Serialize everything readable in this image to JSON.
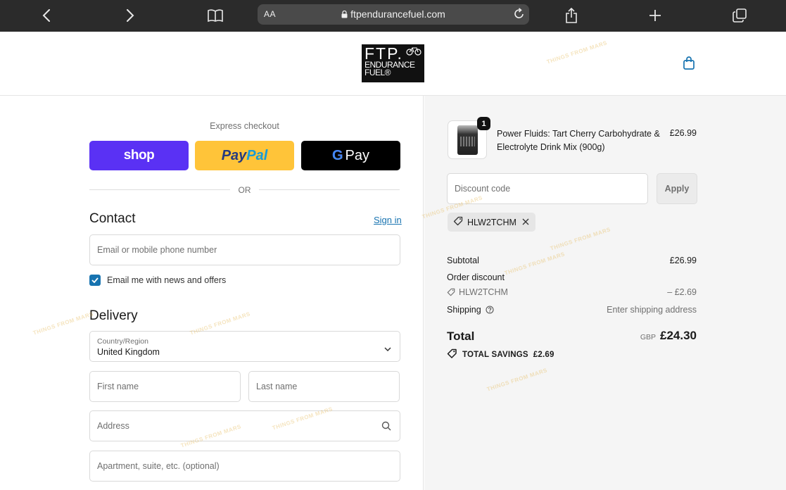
{
  "browser": {
    "text_size_label": "AA",
    "url": "ftpendurancefuel.com"
  },
  "store": {
    "logo_line1": "FTP.",
    "logo_line2": "ENDURANCE",
    "logo_line3": "FUEL®"
  },
  "express": {
    "title": "Express checkout",
    "shop_label": "shop",
    "paypal_pay": "Pay",
    "paypal_pal": "Pal",
    "gpay_g": "G",
    "gpay_label": "Pay",
    "or_label": "OR"
  },
  "contact": {
    "heading": "Contact",
    "sign_in": "Sign in",
    "email_placeholder": "Email or mobile phone number",
    "newsletter_label": "Email me with news and offers",
    "newsletter_checked": true
  },
  "delivery": {
    "heading": "Delivery",
    "country_label": "Country/Region",
    "country_value": "United Kingdom",
    "first_name_placeholder": "First name",
    "last_name_placeholder": "Last name",
    "address_placeholder": "Address",
    "apartment_placeholder": "Apartment, suite, etc. (optional)"
  },
  "order": {
    "item": {
      "quantity": "1",
      "name": "Power Fluids: Tart Cherry Carbohydrate & Electrolyte Drink Mix (900g)",
      "price": "£26.99"
    },
    "discount_placeholder": "Discount code",
    "apply_label": "Apply",
    "applied_code": "HLW2TCHM",
    "subtotal_label": "Subtotal",
    "subtotal_value": "£26.99",
    "order_discount_label": "Order discount",
    "discount_code": "HLW2TCHM",
    "discount_value": "– £2.69",
    "shipping_label": "Shipping",
    "shipping_value": "Enter shipping address",
    "total_label": "Total",
    "currency": "GBP",
    "total_value": "£24.30",
    "savings_label": "TOTAL SAVINGS",
    "savings_value": "£2.69"
  },
  "watermark": "THINGS FROM MARS",
  "colors": {
    "shop": "#5a31f4",
    "paypal": "#ffc439",
    "link": "#1773b0",
    "checkbox": "#1773b0"
  }
}
